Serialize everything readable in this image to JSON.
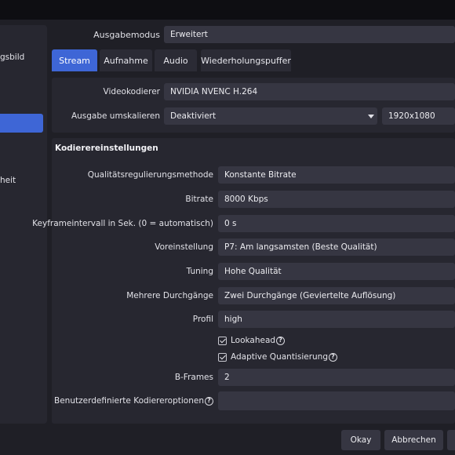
{
  "sidebar": {
    "items": [
      {
        "label": "gsbild"
      },
      {
        "label": ""
      },
      {
        "label": "heit"
      }
    ]
  },
  "output_mode": {
    "label": "Ausgabemodus",
    "value": "Erweitert"
  },
  "tabs": [
    {
      "label": "Stream",
      "active": true
    },
    {
      "label": "Aufnahme",
      "active": false
    },
    {
      "label": "Audio",
      "active": false
    },
    {
      "label": "Wiederholungspuffer",
      "active": false
    }
  ],
  "encoder": {
    "label": "Videokodierer",
    "value": "NVIDIA NVENC H.264"
  },
  "rescale": {
    "label": "Ausgabe umskalieren",
    "value": "Deaktiviert",
    "resolution": "1920x1080"
  },
  "encoder_settings": {
    "title": "Kodierereinstellungen",
    "rate_control": {
      "label": "Qualitätsregulierungsmethode",
      "value": "Konstante Bitrate"
    },
    "bitrate": {
      "label": "Bitrate",
      "value": "8000 Kbps"
    },
    "keyframe": {
      "label": "Keyframeintervall in Sek. (0 = automatisch)",
      "value": "0 s"
    },
    "preset": {
      "label": "Voreinstellung",
      "value": "P7: Am langsamsten (Beste Qualität)"
    },
    "tuning": {
      "label": "Tuning",
      "value": "Hohe Qualität"
    },
    "multipass": {
      "label": "Mehrere Durchgänge",
      "value": "Zwei Durchgänge (Geviertelte Auflösung)"
    },
    "profile": {
      "label": "Profil",
      "value": "high"
    },
    "lookahead": {
      "label": "Lookahead",
      "checked": true
    },
    "adaptive_quant": {
      "label": "Adaptive Quantisierung",
      "checked": true
    },
    "bframes": {
      "label": "B-Frames",
      "value": "2"
    },
    "custom_options": {
      "label": "Benutzerdefinierte Kodiereroptionen",
      "value": ""
    }
  },
  "buttons": {
    "ok": "Okay",
    "cancel": "Abbrechen"
  },
  "icons": {
    "help": "?"
  },
  "colors": {
    "accent": "#3e66d6",
    "background": "#1f1f26",
    "panel": "#272730",
    "field": "#363642"
  }
}
